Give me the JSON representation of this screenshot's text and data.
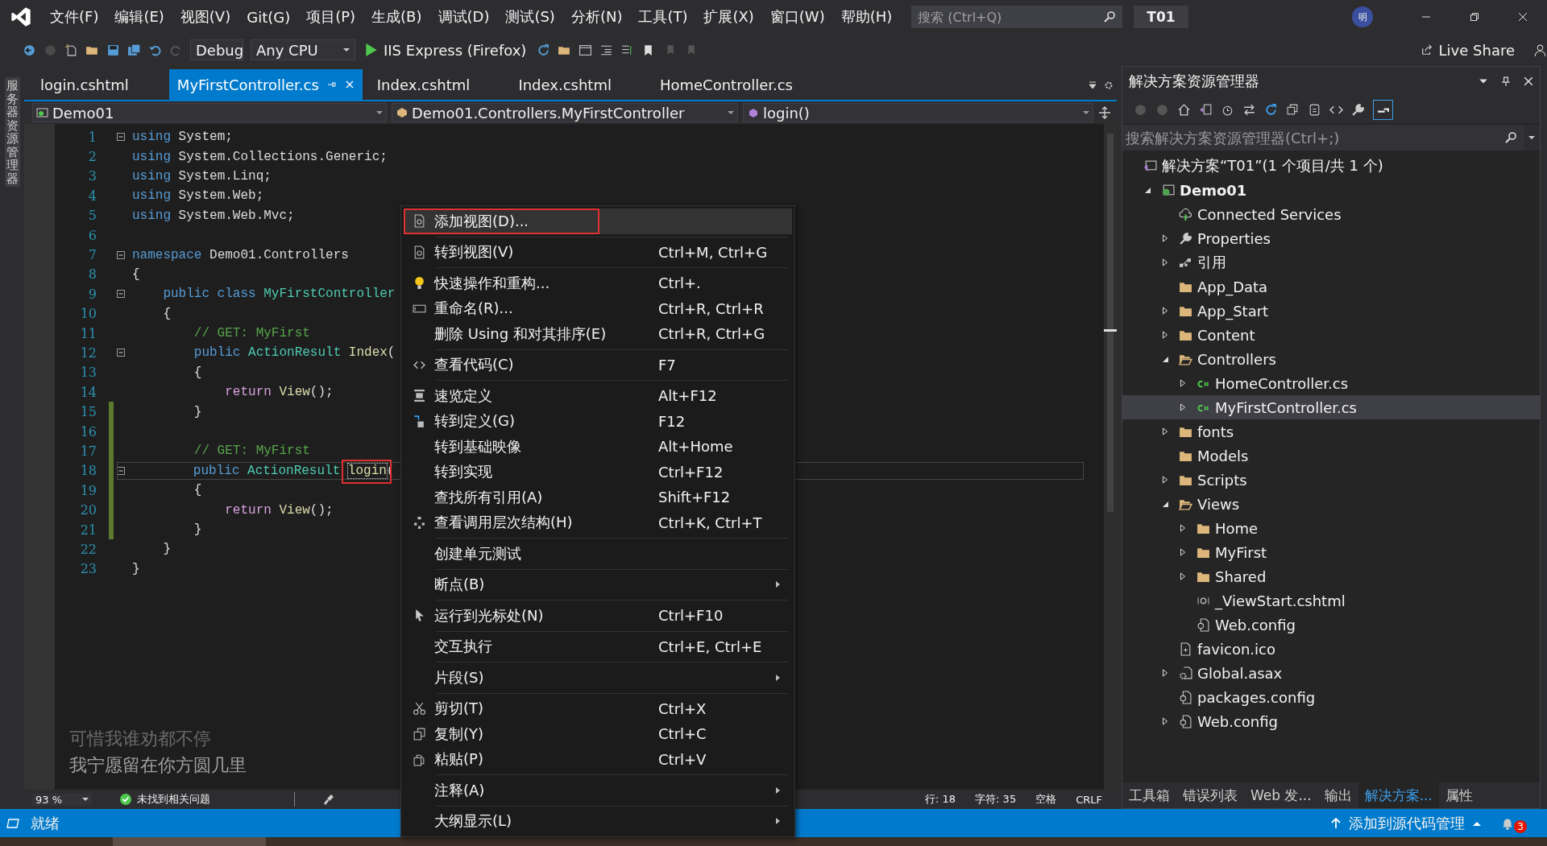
{
  "title_bar": {
    "menus": [
      "文件(F)",
      "编辑(E)",
      "视图(V)",
      "Git(G)",
      "项目(P)",
      "生成(B)",
      "调试(D)",
      "测试(S)",
      "分析(N)",
      "工具(T)",
      "扩展(X)",
      "窗口(W)",
      "帮助(H)"
    ],
    "search": {
      "placeholder": "搜索 (Ctrl+Q)"
    },
    "solution_name": "T01",
    "avatar": "明"
  },
  "toolbar": {
    "configuration": "Debug",
    "platform": "Any CPU",
    "run_target": "IIS Express (Firefox)",
    "live_share": "Live Share"
  },
  "left_strip": {
    "label": "服务器资源管理器"
  },
  "tabs": [
    {
      "label": "login.cshtml",
      "selected": false
    },
    {
      "label": "MyFirstController.cs",
      "selected": true
    },
    {
      "label": "Index.cshtml",
      "selected": false
    },
    {
      "label": "Index.cshtml",
      "selected": false
    },
    {
      "label": "HomeController.cs",
      "selected": false
    }
  ],
  "nav_bar": {
    "project": "Demo01",
    "class": "Demo01.Controllers.MyFirstController",
    "member": "login()"
  },
  "code": {
    "lines": [
      {
        "number": "1",
        "foldable": true,
        "changed": false,
        "current": false,
        "tokens": [
          {
            "text": "using",
            "kind": "kw"
          },
          {
            "text": " System;",
            "kind": "plain"
          }
        ]
      },
      {
        "number": "2",
        "foldable": false,
        "changed": false,
        "current": false,
        "tokens": [
          {
            "text": "using",
            "kind": "kw"
          },
          {
            "text": " System.Collections.Generic;",
            "kind": "plain"
          }
        ]
      },
      {
        "number": "3",
        "foldable": false,
        "changed": false,
        "current": false,
        "tokens": [
          {
            "text": "using",
            "kind": "kw"
          },
          {
            "text": " System.Linq;",
            "kind": "plain"
          }
        ]
      },
      {
        "number": "4",
        "foldable": false,
        "changed": false,
        "current": false,
        "tokens": [
          {
            "text": "using",
            "kind": "kw"
          },
          {
            "text": " System.Web;",
            "kind": "plain"
          }
        ]
      },
      {
        "number": "5",
        "foldable": false,
        "changed": false,
        "current": false,
        "tokens": [
          {
            "text": "using",
            "kind": "kw"
          },
          {
            "text": " System.Web.Mvc;",
            "kind": "plain"
          }
        ]
      },
      {
        "number": "6",
        "foldable": false,
        "changed": false,
        "current": false
      },
      {
        "number": "7",
        "foldable": true,
        "changed": false,
        "current": false,
        "tokens": [
          {
            "text": "namespace",
            "kind": "kw"
          },
          {
            "text": " Demo01.Controllers",
            "kind": "plain"
          }
        ]
      },
      {
        "number": "8",
        "foldable": false,
        "changed": false,
        "current": false,
        "tokens": [
          {
            "text": "{",
            "kind": "plain"
          }
        ]
      },
      {
        "number": "9",
        "foldable": true,
        "changed": false,
        "current": false,
        "tokens": [
          {
            "text": "    public class",
            "kind": "kw"
          },
          {
            "text": " MyFirstController",
            "kind": "type"
          }
        ]
      },
      {
        "number": "10",
        "foldable": false,
        "changed": false,
        "current": false,
        "tokens": [
          {
            "text": "    {",
            "kind": "plain"
          }
        ]
      },
      {
        "number": "11",
        "foldable": false,
        "changed": false,
        "current": false,
        "tokens": [
          {
            "text": "        // GET: MyFirst",
            "kind": "comment"
          }
        ]
      },
      {
        "number": "12",
        "foldable": true,
        "changed": false,
        "current": false,
        "tokens": [
          {
            "text": "        public",
            "kind": "kw"
          },
          {
            "text": " ActionResult",
            "kind": "type"
          },
          {
            "text": " Index",
            "kind": "method"
          },
          {
            "text": "(",
            "kind": "plain"
          }
        ]
      },
      {
        "number": "13",
        "foldable": false,
        "changed": false,
        "current": false,
        "tokens": [
          {
            "text": "        {",
            "kind": "plain"
          }
        ]
      },
      {
        "number": "14",
        "foldable": false,
        "changed": false,
        "current": false,
        "tokens": [
          {
            "text": "            return",
            "kind": "ctrl"
          },
          {
            "text": " View",
            "kind": "method"
          },
          {
            "text": "();",
            "kind": "plain"
          }
        ]
      },
      {
        "number": "15",
        "foldable": false,
        "changed": true,
        "current": false,
        "tokens": [
          {
            "text": "        }",
            "kind": "plain"
          }
        ]
      },
      {
        "number": "16",
        "foldable": false,
        "changed": true,
        "current": false
      },
      {
        "number": "17",
        "foldable": false,
        "changed": true,
        "current": false,
        "tokens": [
          {
            "text": "        // GET: MyFirst",
            "kind": "comment"
          }
        ]
      },
      {
        "number": "18",
        "foldable": true,
        "changed": true,
        "current": true,
        "tokens": [
          {
            "text": "        public",
            "kind": "kw"
          },
          {
            "text": " ActionResult ",
            "kind": "type"
          },
          {
            "text": "login",
            "kind": "marked"
          },
          {
            "text": "(",
            "kind": "plain"
          }
        ]
      },
      {
        "number": "19",
        "foldable": false,
        "changed": true,
        "current": false,
        "tokens": [
          {
            "text": "        {",
            "kind": "plain"
          }
        ]
      },
      {
        "number": "20",
        "foldable": false,
        "changed": true,
        "current": false,
        "tokens": [
          {
            "text": "            return",
            "kind": "ctrl"
          },
          {
            "text": " View",
            "kind": "method"
          },
          {
            "text": "();",
            "kind": "plain"
          }
        ]
      },
      {
        "number": "21",
        "foldable": false,
        "changed": true,
        "current": false,
        "tokens": [
          {
            "text": "        }",
            "kind": "plain"
          }
        ]
      },
      {
        "number": "22",
        "foldable": false,
        "changed": false,
        "current": false,
        "tokens": [
          {
            "text": "    }",
            "kind": "plain"
          }
        ]
      },
      {
        "number": "23",
        "foldable": false,
        "changed": false,
        "current": false,
        "tokens": [
          {
            "text": "}",
            "kind": "plain"
          }
        ]
      }
    ]
  },
  "lyrics": [
    "可惜我谁劝都不停",
    "我宁愿留在你方圆几里"
  ],
  "editor_status": {
    "zoom": "93 %",
    "issues": "未找到相关问题",
    "line": "行: 18",
    "column": "字符: 35",
    "indent": "空格",
    "line_ending": "CRLF"
  },
  "context_menu": {
    "groups": [
      [
        {
          "kind": "view",
          "label": "添加视图(D)...",
          "submenu": false,
          "selected": true,
          "annotated": true
        }
      ],
      [
        {
          "kind": "view",
          "label": "转到视图(V)",
          "shortcut": "Ctrl+M, Ctrl+G",
          "submenu": false,
          "selected": false,
          "annotated": false
        }
      ],
      [
        {
          "kind": "bulb",
          "label": "快速操作和重构...",
          "shortcut": "Ctrl+.",
          "submenu": false,
          "selected": false,
          "annotated": false
        },
        {
          "kind": "rename",
          "label": "重命名(R)...",
          "shortcut": "Ctrl+R, Ctrl+R",
          "submenu": false,
          "selected": false,
          "annotated": false
        },
        {
          "kind": "plain",
          "label": "删除 Using 和对其排序(E)",
          "shortcut": "Ctrl+R, Ctrl+G",
          "submenu": false,
          "selected": false,
          "annotated": false
        }
      ],
      [
        {
          "kind": "code",
          "label": "查看代码(C)",
          "shortcut": "F7",
          "submenu": false,
          "selected": false,
          "annotated": false
        }
      ],
      [
        {
          "kind": "peek",
          "label": "速览定义",
          "shortcut": "Alt+F12",
          "submenu": false,
          "selected": false,
          "annotated": false
        },
        {
          "kind": "goto",
          "label": "转到定义(G)",
          "shortcut": "F12",
          "submenu": false,
          "selected": false,
          "annotated": false
        },
        {
          "kind": "plain",
          "label": "转到基础映像",
          "shortcut": "Alt+Home",
          "submenu": false,
          "selected": false,
          "annotated": false
        },
        {
          "kind": "plain",
          "label": "转到实现",
          "shortcut": "Ctrl+F12",
          "submenu": false,
          "selected": false,
          "annotated": false
        },
        {
          "kind": "plain",
          "label": "查找所有引用(A)",
          "shortcut": "Shift+F12",
          "submenu": false,
          "selected": false,
          "annotated": false
        },
        {
          "kind": "hierarchy",
          "label": "查看调用层次结构(H)",
          "shortcut": "Ctrl+K, Ctrl+T",
          "submenu": false,
          "selected": false,
          "annotated": false
        }
      ],
      [
        {
          "kind": "plain",
          "label": "创建单元测试",
          "submenu": false,
          "selected": false,
          "annotated": false
        }
      ],
      [
        {
          "kind": "plain",
          "label": "断点(B)",
          "submenu": true,
          "selected": false,
          "annotated": false
        }
      ],
      [
        {
          "kind": "cursor",
          "label": "运行到光标处(N)",
          "shortcut": "Ctrl+F10",
          "submenu": false,
          "selected": false,
          "annotated": false
        }
      ],
      [
        {
          "kind": "plain",
          "label": "交互执行",
          "shortcut": "Ctrl+E, Ctrl+E",
          "submenu": false,
          "selected": false,
          "annotated": false
        }
      ],
      [
        {
          "kind": "plain",
          "label": "片段(S)",
          "submenu": true,
          "selected": false,
          "annotated": false
        }
      ],
      [
        {
          "kind": "cut",
          "label": "剪切(T)",
          "shortcut": "Ctrl+X",
          "submenu": false,
          "selected": false,
          "annotated": false
        },
        {
          "kind": "copy",
          "label": "复制(Y)",
          "shortcut": "Ctrl+C",
          "submenu": false,
          "selected": false,
          "annotated": false
        },
        {
          "kind": "paste",
          "label": "粘贴(P)",
          "shortcut": "Ctrl+V",
          "submenu": false,
          "selected": false,
          "annotated": false
        }
      ],
      [
        {
          "kind": "plain",
          "label": "注释(A)",
          "submenu": true,
          "selected": false,
          "annotated": false
        }
      ],
      [
        {
          "kind": "plain",
          "label": "大纲显示(L)",
          "submenu": true,
          "selected": false,
          "annotated": false
        }
      ]
    ]
  },
  "solution_explorer": {
    "title": "解决方案资源管理器",
    "search": {
      "placeholder": "搜索解决方案资源管理器(Ctrl+;)"
    },
    "tree": [
      {
        "label": "解决方案“T01”(1 个项目/共 1 个)",
        "kind": "solution",
        "expandable": false,
        "selected": false,
        "children": [
          {
            "label": "Demo01",
            "kind": "project",
            "expandable": true,
            "expanded": true,
            "selected": false,
            "children": [
              {
                "label": "Connected Services",
                "kind": "cloud",
                "expandable": false,
                "selected": false
              },
              {
                "label": "Properties",
                "kind": "wrench",
                "expandable": true,
                "expanded": false,
                "selected": false
              },
              {
                "label": "引用",
                "kind": "references",
                "expandable": true,
                "expanded": false,
                "selected": false
              },
              {
                "label": "App_Data",
                "kind": "folder",
                "expandable": false,
                "selected": false
              },
              {
                "label": "App_Start",
                "kind": "folder",
                "expandable": true,
                "expanded": false,
                "selected": false
              },
              {
                "label": "Content",
                "kind": "folder",
                "expandable": true,
                "expanded": false,
                "selected": false
              },
              {
                "label": "Controllers",
                "kind": "folder",
                "expandable": true,
                "expanded": true,
                "selected": false,
                "children": [
                  {
                    "label": "HomeController.cs",
                    "kind": "csharp",
                    "expandable": true,
                    "expanded": false,
                    "selected": false
                  },
                  {
                    "label": "MyFirstController.cs",
                    "kind": "csharp",
                    "expandable": true,
                    "expanded": false,
                    "selected": true
                  }
                ]
              },
              {
                "label": "fonts",
                "kind": "folder",
                "expandable": true,
                "expanded": false,
                "selected": false
              },
              {
                "label": "Models",
                "kind": "folder",
                "expandable": false,
                "selected": false
              },
              {
                "label": "Scripts",
                "kind": "folder",
                "expandable": true,
                "expanded": false,
                "selected": false
              },
              {
                "label": "Views",
                "kind": "folder",
                "expandable": true,
                "expanded": true,
                "selected": false,
                "children": [
                  {
                    "label": "Home",
                    "kind": "folder",
                    "expandable": true,
                    "expanded": false,
                    "selected": false
                  },
                  {
                    "label": "MyFirst",
                    "kind": "folder",
                    "expandable": true,
                    "expanded": false,
                    "selected": false
                  },
                  {
                    "label": "Shared",
                    "kind": "folder",
                    "expandable": true,
                    "expanded": false,
                    "selected": false
                  },
                  {
                    "label": "_ViewStart.cshtml",
                    "kind": "razor",
                    "expandable": false,
                    "selected": false
                  },
                  {
                    "label": "Web.config",
                    "kind": "config",
                    "expandable": false,
                    "selected": false
                  }
                ]
              },
              {
                "label": "favicon.ico",
                "kind": "file",
                "expandable": false,
                "selected": false
              },
              {
                "label": "Global.asax",
                "kind": "asax",
                "expandable": true,
                "expanded": false,
                "selected": false
              },
              {
                "label": "packages.config",
                "kind": "config",
                "expandable": false,
                "selected": false
              },
              {
                "label": "Web.config",
                "kind": "config",
                "expandable": true,
                "expanded": false,
                "selected": false
              }
            ]
          }
        ]
      }
    ]
  },
  "panel_tabs": [
    {
      "label": "工具箱",
      "selected": false
    },
    {
      "label": "错误列表",
      "selected": false
    },
    {
      "label": "Web 发...",
      "selected": false
    },
    {
      "label": "输出",
      "selected": false
    },
    {
      "label": "解决方案...",
      "selected": true
    },
    {
      "label": "属性",
      "selected": false
    }
  ],
  "status_bar": {
    "state": "就绪",
    "source_control": "添加到源代码管理",
    "notifications": "3"
  }
}
